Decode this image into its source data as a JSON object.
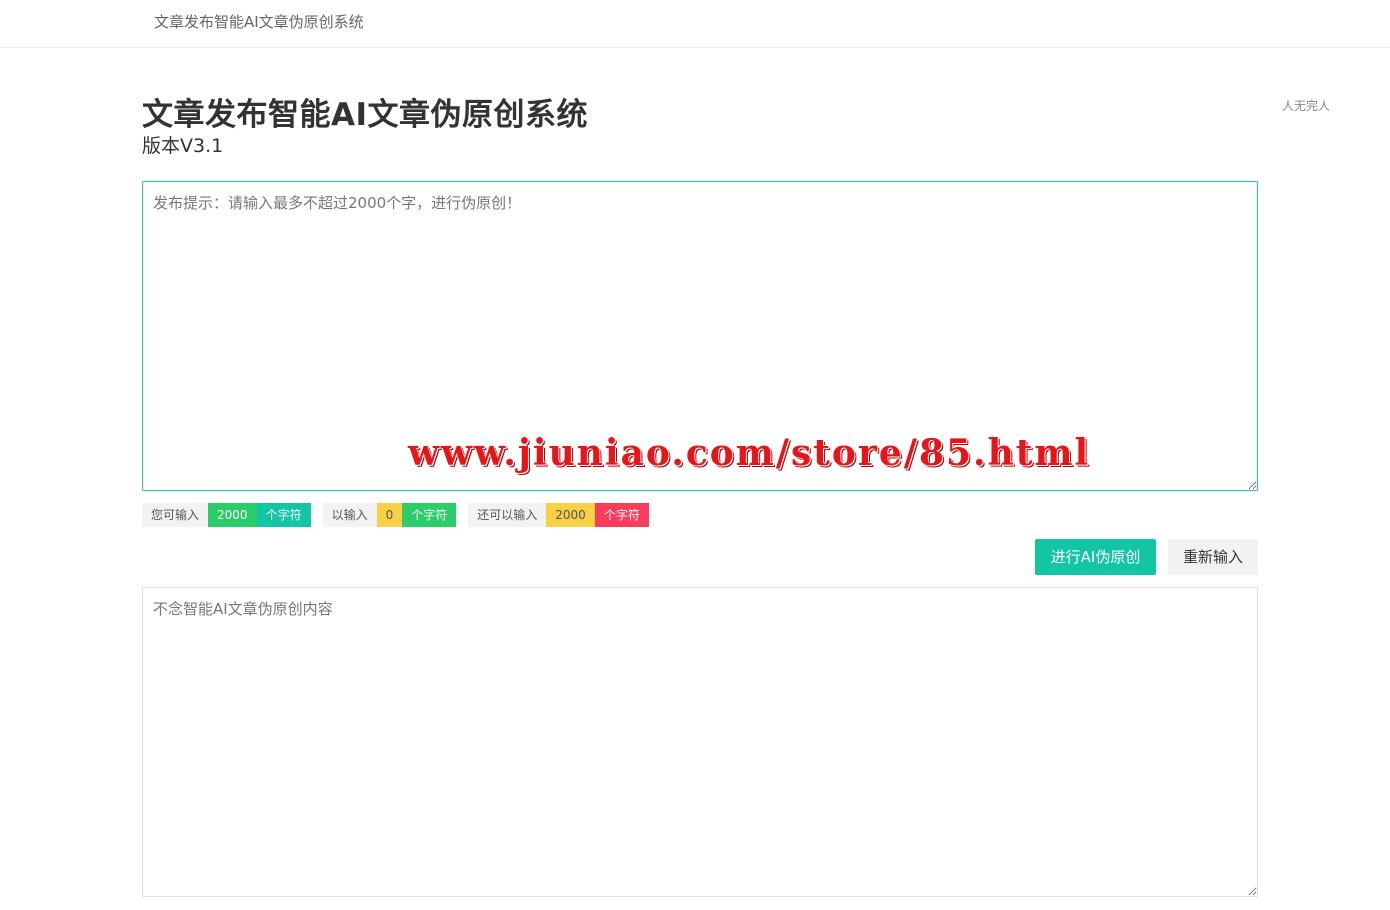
{
  "header": {
    "brand": "文章发布智能AI文章伪原创系统"
  },
  "author": "人无完人",
  "main": {
    "title": "文章发布智能AI文章伪原创系统",
    "version": "版本V3.1",
    "input_placeholder": "发布提示：请输入最多不超过2000个字，进行伪原创！",
    "input_value": "",
    "watermark": "www.jiuniao.com/store/85.html",
    "output_placeholder": "不念智能AI文章伪原创内容",
    "output_value": ""
  },
  "counters": [
    {
      "label": "您可输入",
      "value": "2000",
      "unit": "个字符"
    },
    {
      "label": "以输入",
      "value": "0",
      "unit": "个字符"
    },
    {
      "label": "还可以输入",
      "value": "2000",
      "unit": "个字符"
    }
  ],
  "buttons": {
    "rewrite_label": "进行AI伪原创",
    "reset_label": "重新输入"
  },
  "colors": {
    "accent": "#12c6a4",
    "green": "#2bcc6a",
    "yellow": "#f7d046",
    "red": "#fa3d5c"
  }
}
